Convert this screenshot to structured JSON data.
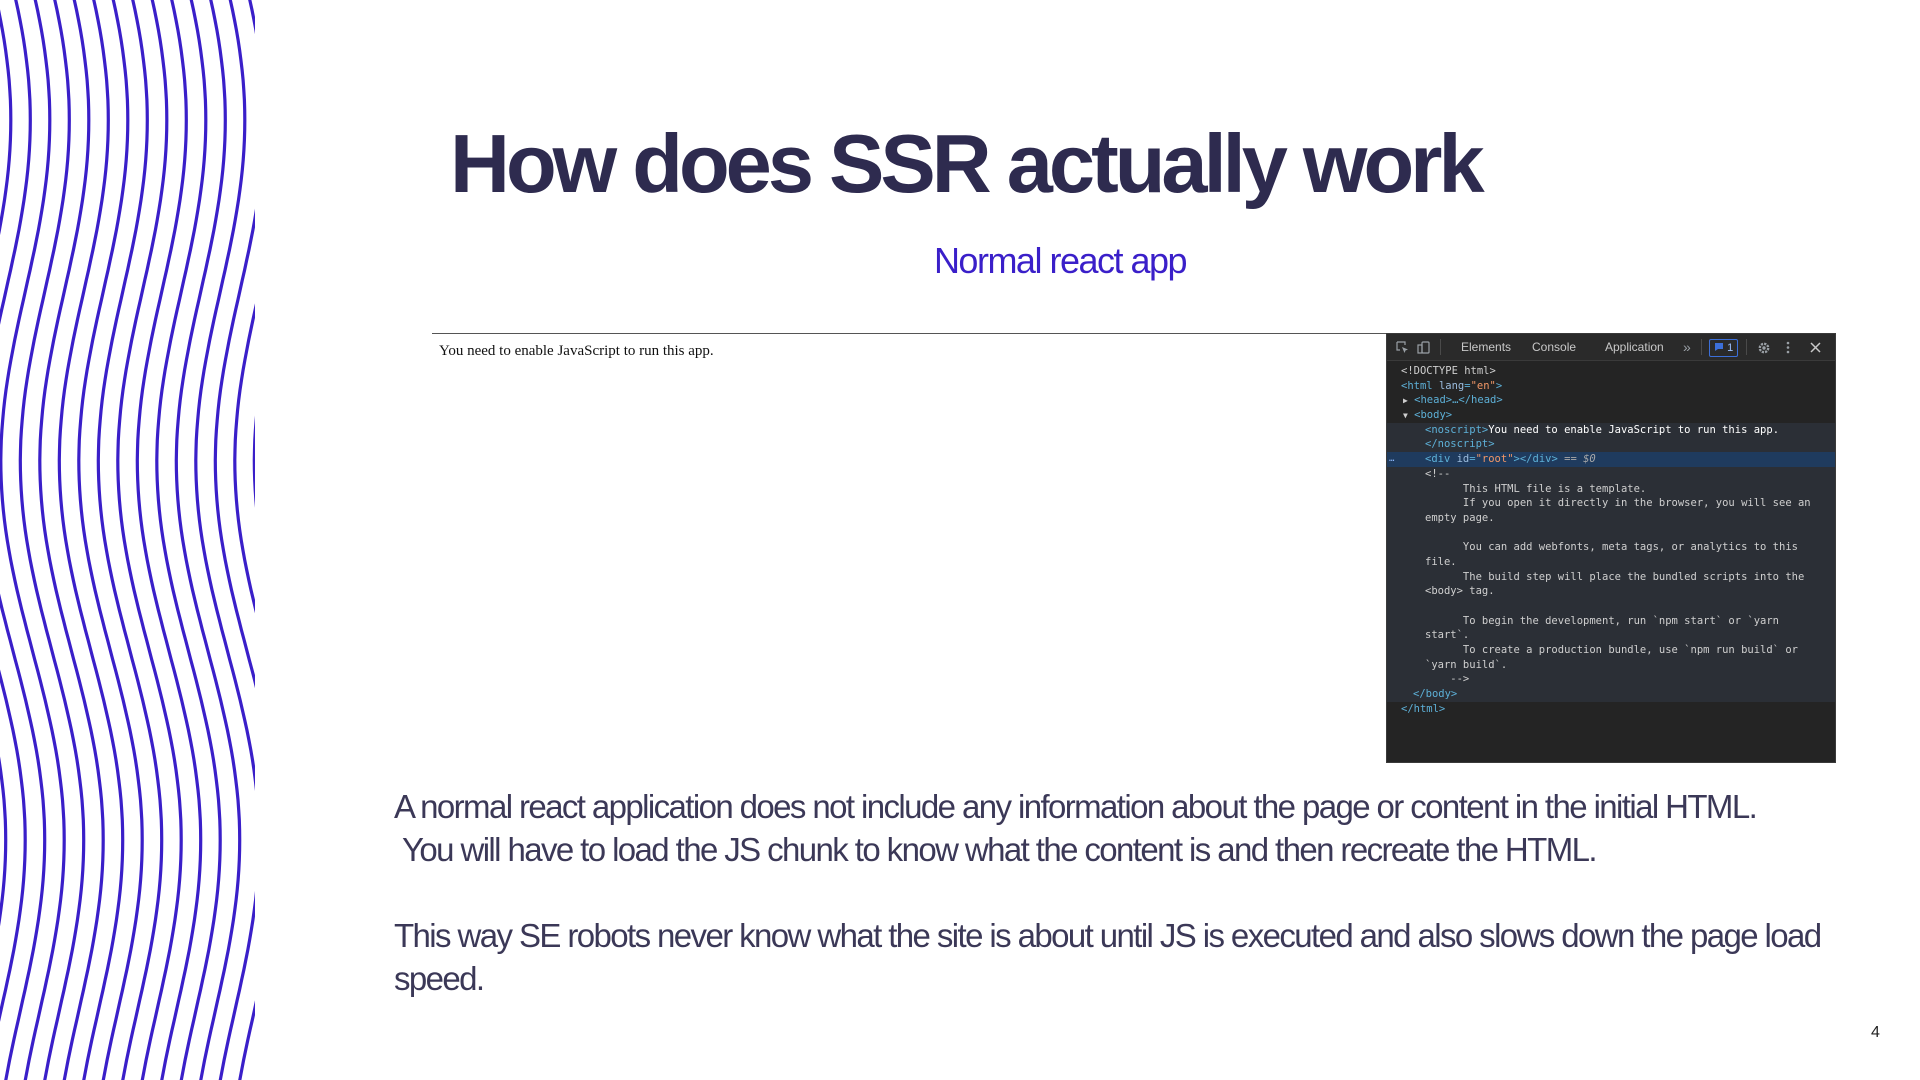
{
  "slide": {
    "title": "How does SSR actually work",
    "subtitle": "Normal react app",
    "paragraph_1_line_1": "A normal react application does not include any information about the page or content in the initial HTML.",
    "paragraph_1_line_2": "You will have to load the JS chunk to know what the content is and then recreate the HTML.",
    "paragraph_2": "This way SE robots never know what the site is about until JS is executed and also slows down the page load speed.",
    "page_number": "4",
    "accent_color": "#3a1fc9",
    "title_color": "#2e2b4f",
    "decoration": "wavy-stripes"
  },
  "browser_page": {
    "noscript_text": "You need to enable JavaScript to run this app."
  },
  "devtools": {
    "tabs": [
      "Elements",
      "Console",
      "Application"
    ],
    "active_tab": "Elements",
    "more_tabs": "»",
    "issues_count": "1",
    "icons": [
      "inspect-element-icon",
      "device-toolbar-icon",
      "issues-icon",
      "settings-gear-icon",
      "kebab-menu-icon",
      "close-icon"
    ],
    "code": {
      "doctype": "<!DOCTYPE html>",
      "html_open": {
        "tag": "<html ",
        "attr": "lang",
        "eq": "=",
        "val": "\"en\"",
        "end": ">"
      },
      "head_collapsed": "<head>…</head>",
      "body_open": "<body>",
      "noscript_open": "<noscript>",
      "noscript_text": "You need to enable JavaScript to run this app.",
      "noscript_close": "</noscript>",
      "div_root": {
        "tag": "<div ",
        "attr": "id",
        "eq": "=",
        "val": "\"root\"",
        "end": "></div>",
        "marker": "== $0"
      },
      "selected_gutter": "…",
      "comment_lines": [
        "<!--",
        "      This HTML file is a template.",
        "      If you open it directly in the browser, you will see an",
        "empty page.",
        "",
        "      You can add webfonts, meta tags, or analytics to this",
        "file.",
        "      The build step will place the bundled scripts into the",
        "<body> tag.",
        "",
        "      To begin the development, run `npm start` or `yarn",
        "start`.",
        "      To create a production bundle, use `npm run build` or",
        "`yarn build`.",
        "    -->"
      ],
      "body_close": "</body>",
      "html_close": "</html>"
    }
  }
}
